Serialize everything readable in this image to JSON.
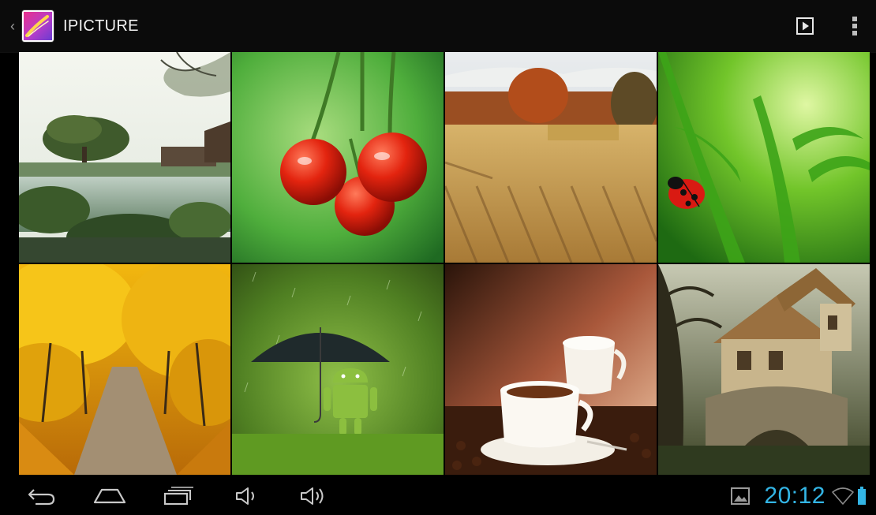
{
  "action_bar": {
    "title": "IPICTURE",
    "app_icon": "gallery-app-icon",
    "slideshow_icon": "play-icon",
    "overflow_icon": "overflow-menu-icon"
  },
  "photos": [
    {
      "subject": "chinese-garden-lake"
    },
    {
      "subject": "cherries"
    },
    {
      "subject": "wheat-field-autumn-tree"
    },
    {
      "subject": "ladybug-on-grass"
    },
    {
      "subject": "golden-autumn-road"
    },
    {
      "subject": "android-with-umbrella-rain"
    },
    {
      "subject": "coffee-cups"
    },
    {
      "subject": "fantasy-tree-house"
    }
  ],
  "system_bar": {
    "time": "20:12",
    "nav_icons": [
      "back-icon",
      "home-icon",
      "recents-icon",
      "volume-down-icon",
      "volume-up-icon"
    ],
    "status_icons": [
      "screenshot-icon",
      "wifi-icon",
      "battery-icon"
    ],
    "clock_color": "#33b5e5"
  }
}
